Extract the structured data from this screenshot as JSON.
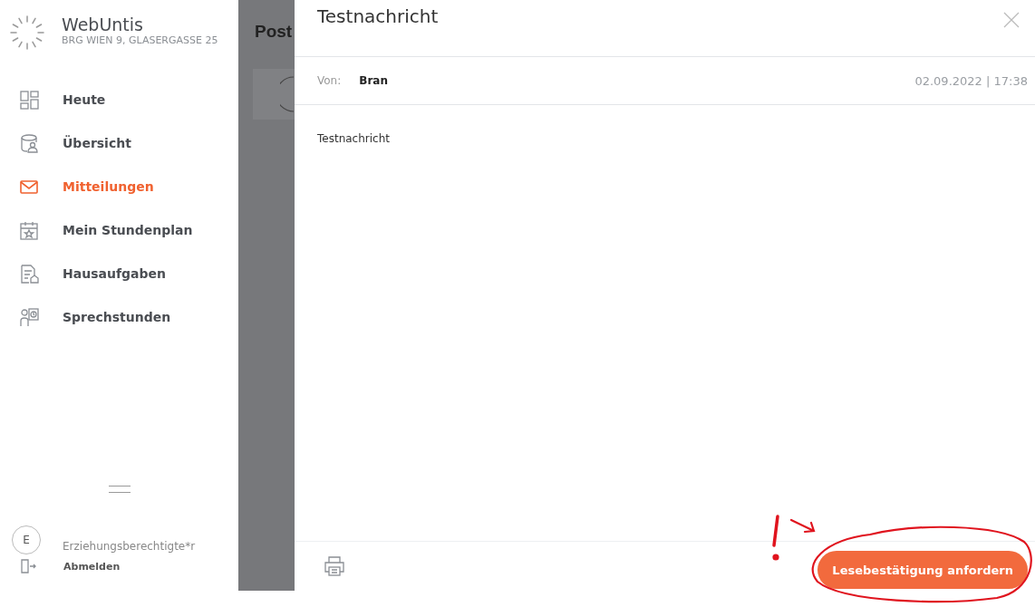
{
  "sidebar": {
    "app_name": "WebUntis",
    "school": "BRG WIEN 9, GLASERGASSE 25",
    "items": [
      {
        "label": "Heute",
        "kind": "today",
        "selected": false
      },
      {
        "label": "Übersicht",
        "kind": "overview",
        "selected": false
      },
      {
        "label": "Mitteilungen",
        "kind": "messages",
        "selected": true
      },
      {
        "label": "Mein Stundenplan",
        "kind": "timetable",
        "selected": false
      },
      {
        "label": "Hausaufgaben",
        "kind": "homework",
        "selected": false
      },
      {
        "label": "Sprechstunden",
        "kind": "office_hours",
        "selected": false
      }
    ],
    "user": {
      "initial": "E",
      "role": "Erziehungsberechtigte*r"
    },
    "logout": "Abmelden"
  },
  "background_page": {
    "title": "Post"
  },
  "dialog": {
    "title": "Testnachricht",
    "from_label": "Von:",
    "from": "Bran",
    "date": "02.09.2022",
    "separator": "|",
    "time": "17:38",
    "body": "Testnachricht",
    "action": "Lesebestätigung anfordern"
  }
}
